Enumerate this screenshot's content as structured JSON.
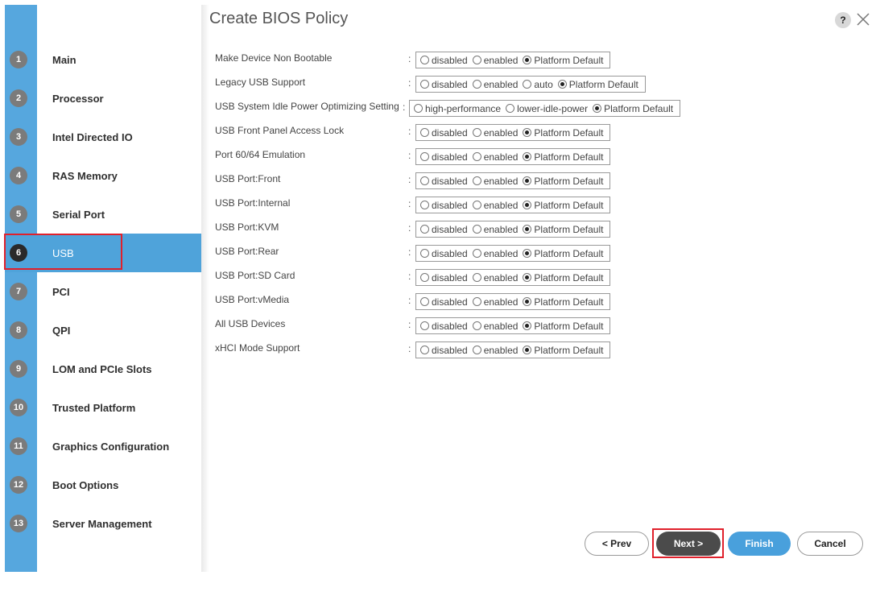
{
  "title": "Create BIOS Policy",
  "header": {
    "help_label": "?",
    "close_icon": "close-icon"
  },
  "steps": [
    {
      "num": "1",
      "label": "Main"
    },
    {
      "num": "2",
      "label": "Processor"
    },
    {
      "num": "3",
      "label": "Intel Directed IO"
    },
    {
      "num": "4",
      "label": "RAS Memory"
    },
    {
      "num": "5",
      "label": "Serial Port"
    },
    {
      "num": "6",
      "label": "USB",
      "active": true
    },
    {
      "num": "7",
      "label": "PCI"
    },
    {
      "num": "8",
      "label": "QPI"
    },
    {
      "num": "9",
      "label": "LOM and PCIe Slots"
    },
    {
      "num": "10",
      "label": "Trusted Platform"
    },
    {
      "num": "11",
      "label": "Graphics Configuration"
    },
    {
      "num": "12",
      "label": "Boot Options"
    },
    {
      "num": "13",
      "label": "Server Management"
    }
  ],
  "fields": [
    {
      "label": "Make Device Non Bootable",
      "options": [
        "disabled",
        "enabled",
        "Platform Default"
      ],
      "selected": "Platform Default"
    },
    {
      "label": "Legacy USB Support",
      "options": [
        "disabled",
        "enabled",
        "auto",
        "Platform Default"
      ],
      "selected": "Platform Default"
    },
    {
      "label": "USB System Idle Power Optimizing Setting",
      "options": [
        "high-performance",
        "lower-idle-power",
        "Platform Default"
      ],
      "selected": "Platform Default",
      "wide": true
    },
    {
      "label": "USB Front Panel Access Lock",
      "options": [
        "disabled",
        "enabled",
        "Platform Default"
      ],
      "selected": "Platform Default"
    },
    {
      "label": "Port 60/64 Emulation",
      "options": [
        "disabled",
        "enabled",
        "Platform Default"
      ],
      "selected": "Platform Default"
    },
    {
      "label": "USB Port:Front",
      "options": [
        "disabled",
        "enabled",
        "Platform Default"
      ],
      "selected": "Platform Default"
    },
    {
      "label": "USB Port:Internal",
      "options": [
        "disabled",
        "enabled",
        "Platform Default"
      ],
      "selected": "Platform Default"
    },
    {
      "label": "USB Port:KVM",
      "options": [
        "disabled",
        "enabled",
        "Platform Default"
      ],
      "selected": "Platform Default"
    },
    {
      "label": "USB Port:Rear",
      "options": [
        "disabled",
        "enabled",
        "Platform Default"
      ],
      "selected": "Platform Default"
    },
    {
      "label": "USB Port:SD Card",
      "options": [
        "disabled",
        "enabled",
        "Platform Default"
      ],
      "selected": "Platform Default"
    },
    {
      "label": "USB Port:vMedia",
      "options": [
        "disabled",
        "enabled",
        "Platform Default"
      ],
      "selected": "Platform Default"
    },
    {
      "label": "All USB Devices",
      "options": [
        "disabled",
        "enabled",
        "Platform Default"
      ],
      "selected": "Platform Default"
    },
    {
      "label": "xHCI Mode Support",
      "options": [
        "disabled",
        "enabled",
        "Platform Default"
      ],
      "selected": "Platform Default"
    }
  ],
  "buttons": {
    "prev": "< Prev",
    "next": "Next >",
    "finish": "Finish",
    "cancel": "Cancel"
  },
  "colors": {
    "sidebar_blue": "#56a7de",
    "active_step": "#4fa3da",
    "finish_blue": "#49a0dc",
    "next_dark": "#4b4b4b",
    "highlight_red": "#e0202b"
  }
}
